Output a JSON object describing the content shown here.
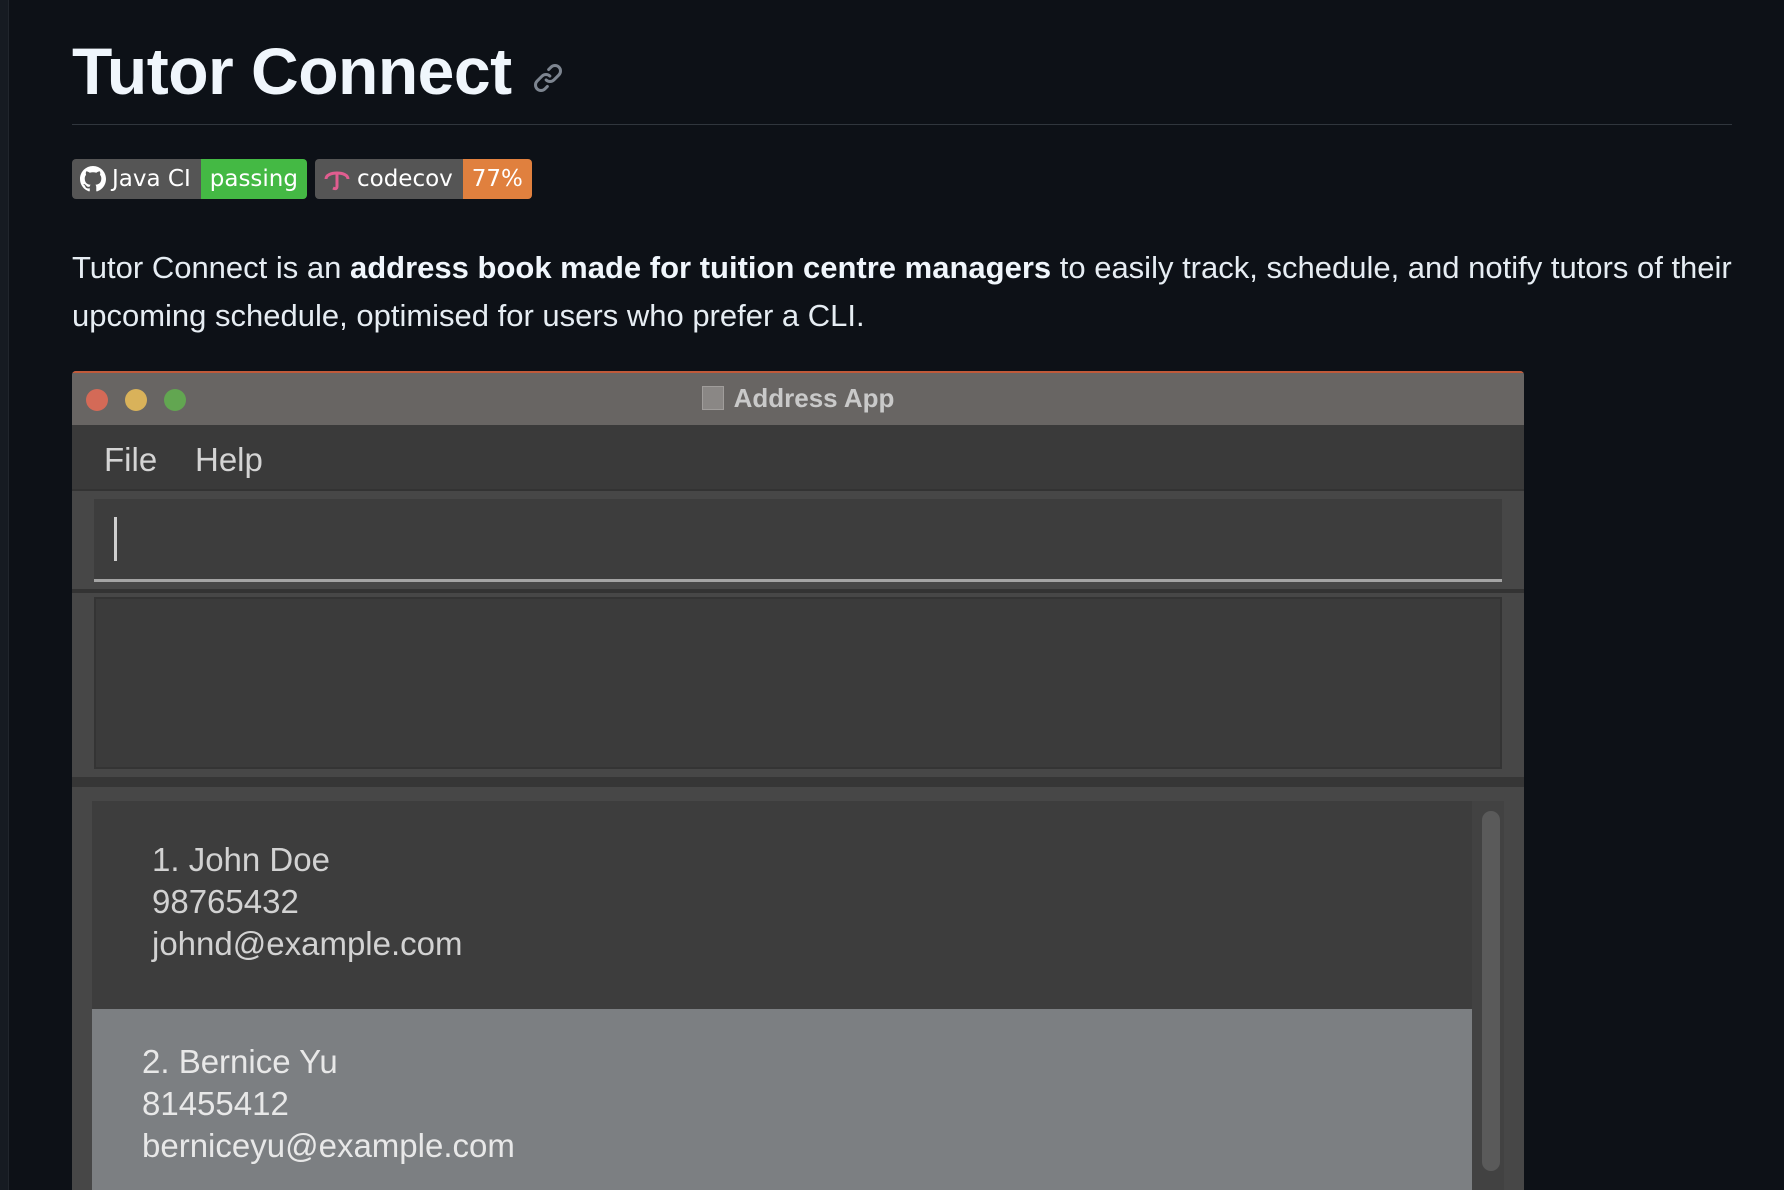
{
  "page": {
    "title": "Tutor Connect",
    "badges": [
      {
        "label": "Java CI",
        "status": "passing",
        "status_color": "#44b944"
      },
      {
        "label": "codecov",
        "status": "77%",
        "status_color": "#e0803e"
      }
    ],
    "description": {
      "part1": "Tutor Connect is an ",
      "bold": "address book made for tuition centre managers",
      "part2": " to easily track, schedule, and notify tutors of their upcoming schedule, optimised for users who prefer a CLI."
    }
  },
  "app": {
    "window_title": "Address App",
    "menu": [
      "File",
      "Help"
    ],
    "command_value": "",
    "persons": [
      {
        "name": "1. John Doe",
        "phone": "98765432",
        "email": "johnd@example.com"
      },
      {
        "name": "2. Bernice Yu",
        "phone": "81455412",
        "email": "berniceyu@example.com"
      }
    ]
  },
  "colors": {
    "page_bg": "#0d1117",
    "selected_card": "#7c7f82"
  }
}
